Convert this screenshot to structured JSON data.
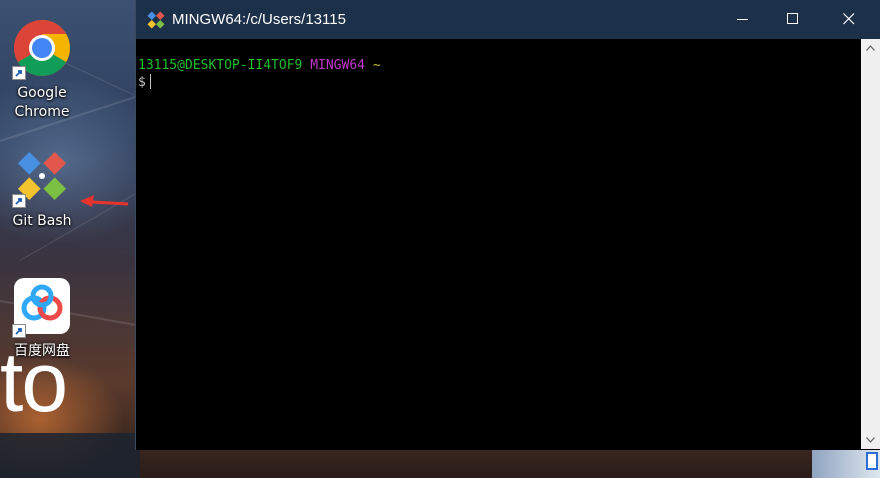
{
  "desktop": {
    "wallpaper_text": "to",
    "icons": [
      {
        "label_line1": "Google",
        "label_line2": "Chrome",
        "icon": "chrome-icon"
      },
      {
        "label_line1": "Git Bash",
        "icon": "git-bash-icon"
      },
      {
        "label_line1": "百度网盘",
        "icon": "baidu-netdisk-icon"
      }
    ],
    "annotation": "red-arrow-pointing-left"
  },
  "window": {
    "title": "MINGW64:/c/Users/13115",
    "icon": "git-bash-icon",
    "controls": [
      "minimize-icon",
      "maximize-icon",
      "close-icon"
    ]
  },
  "terminal": {
    "prompt_user_host": "13115@DESKTOP-II4TOF9",
    "prompt_env": "MINGW64",
    "prompt_path": "~",
    "prompt_symbol": "$",
    "colors": {
      "user_host": "#1fbf2f",
      "env": "#c036c9",
      "path": "#bfbf2a",
      "background": "#000000"
    }
  }
}
